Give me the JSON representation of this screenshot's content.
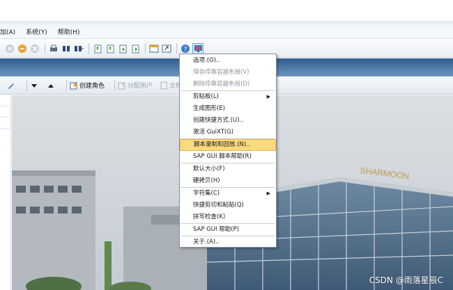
{
  "menubar": {
    "items": [
      {
        "label": "加(A)"
      },
      {
        "label": "系统(Y)"
      },
      {
        "label": "帮助(H)"
      }
    ]
  },
  "toolbar": {
    "icons": [
      "nav-back-icon",
      "nav-exit-icon",
      "cancel-icon",
      "print-icon",
      "find-icon",
      "find-next-icon",
      "first-page-icon",
      "prev-page-icon",
      "next-page-icon",
      "last-page-icon",
      "new-session-icon",
      "shortcut-icon",
      "help-icon",
      "customize-layout-icon"
    ]
  },
  "app_toolbar": {
    "create_role": "创建角色",
    "assign_users": "分配用户",
    "documents": "文档"
  },
  "popup_menu": {
    "items": [
      {
        "label": "选项.(O)..",
        "disabled": false,
        "submenu": false,
        "highlighted": false
      },
      {
        "label": "保存停靠容器布局(V)",
        "disabled": true,
        "submenu": false,
        "highlighted": false
      },
      {
        "label": "删除停靠容器布局(D)",
        "disabled": true,
        "submenu": false,
        "highlighted": false
      },
      {
        "sep": true
      },
      {
        "label": "剪贴板(L)",
        "disabled": false,
        "submenu": true,
        "highlighted": false
      },
      {
        "label": "生成图形(E)",
        "disabled": false,
        "submenu": false,
        "highlighted": false
      },
      {
        "label": "创建快捷方式.(U)..",
        "disabled": false,
        "submenu": false,
        "highlighted": false
      },
      {
        "label": "激活 GuiXT(G)",
        "disabled": false,
        "submenu": false,
        "highlighted": false
      },
      {
        "sep": true
      },
      {
        "label": "脚本录制和回放.(N)..",
        "disabled": false,
        "submenu": false,
        "highlighted": true
      },
      {
        "label": "SAP GUI 脚本帮助(R)",
        "disabled": false,
        "submenu": false,
        "highlighted": false
      },
      {
        "sep": true
      },
      {
        "label": "默认大小(F)",
        "disabled": false,
        "submenu": false,
        "highlighted": false
      },
      {
        "label": "硬拷贝(H)",
        "disabled": false,
        "submenu": false,
        "highlighted": false
      },
      {
        "sep": true
      },
      {
        "label": "字符集(C)",
        "disabled": false,
        "submenu": true,
        "highlighted": false
      },
      {
        "label": "快捷剪切和粘贴(Q)",
        "disabled": false,
        "submenu": false,
        "highlighted": false
      },
      {
        "label": "拼写检查(K)",
        "disabled": false,
        "submenu": false,
        "highlighted": false
      },
      {
        "sep": true
      },
      {
        "label": "SAP GUI 帮助(P)",
        "disabled": false,
        "submenu": false,
        "highlighted": false
      },
      {
        "sep": true
      },
      {
        "label": "关于.(A)..",
        "disabled": false,
        "submenu": false,
        "highlighted": false
      }
    ]
  },
  "background_image": {
    "sign": "SHARMOON"
  },
  "watermark": "CSDN @雨落星辰C",
  "colors": {
    "highlight": "#fbd97d",
    "title_strip": "#2d5e8f",
    "disabled_text": "#8f959c"
  }
}
